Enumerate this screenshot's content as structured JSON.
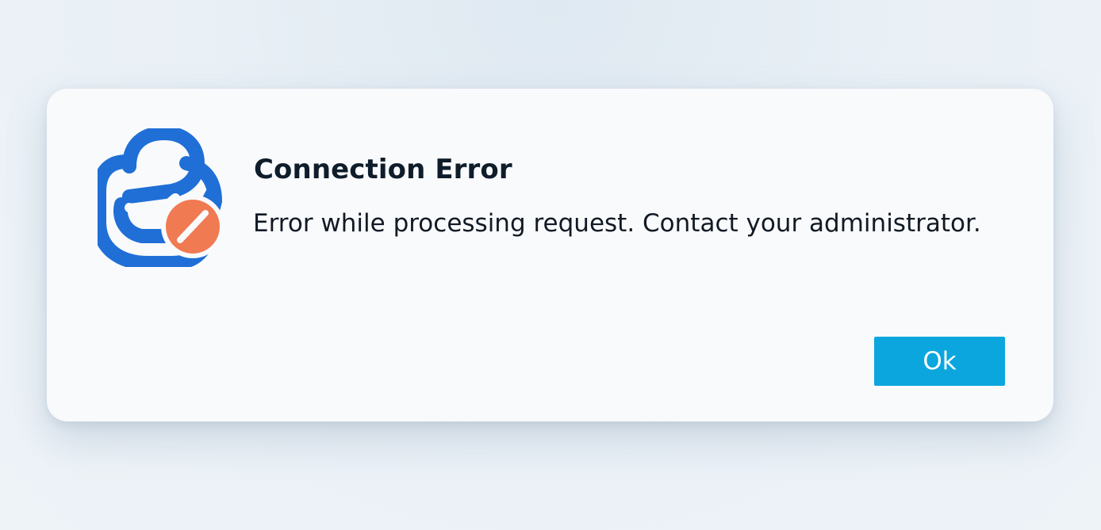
{
  "dialog": {
    "title": "Connection Error",
    "message": "Error while processing request. Contact your administrator.",
    "ok_label": "Ok",
    "icon": "lock-error-icon"
  },
  "colors": {
    "brand_blue": "#1f6fd6",
    "error_orange": "#f07a52",
    "button_blue": "#0ba6de"
  }
}
